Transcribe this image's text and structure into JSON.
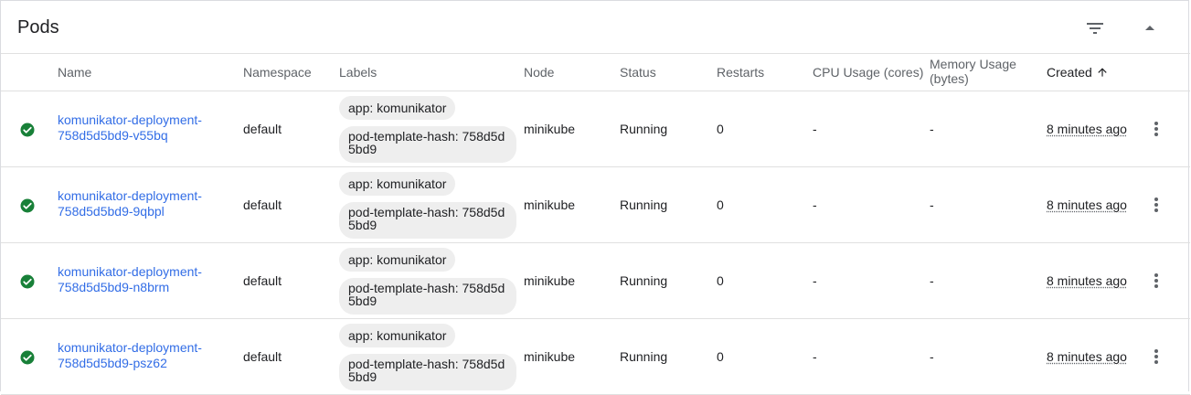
{
  "card": {
    "title": "Pods",
    "filter_icon": "filter-list-icon",
    "collapse_icon": "arrow-drop-up-icon"
  },
  "columns": {
    "name": "Name",
    "namespace": "Namespace",
    "labels": "Labels",
    "node": "Node",
    "status": "Status",
    "restarts": "Restarts",
    "cpu": "CPU Usage (cores)",
    "memory_line1": "Memory Usage",
    "memory_line2": "(bytes)",
    "created": "Created",
    "created_sort_icon": "arrow-upward-icon"
  },
  "colors": {
    "link": "#326de6",
    "success": "#188038",
    "chip_bg": "#eeeeee"
  },
  "pods": [
    {
      "status_icon": "check-circle-icon",
      "name_line1": "komunikator-deployment-",
      "name_line2": "758d5d5bd9-v55bq",
      "namespace": "default",
      "label1": "app: komunikator",
      "label2": "pod-template-hash: 758d5d5bd9",
      "node": "minikube",
      "status": "Running",
      "restarts": "0",
      "cpu": "-",
      "memory": "-",
      "created": "8 minutes ago"
    },
    {
      "status_icon": "check-circle-icon",
      "name_line1": "komunikator-deployment-",
      "name_line2": "758d5d5bd9-9qbpl",
      "namespace": "default",
      "label1": "app: komunikator",
      "label2": "pod-template-hash: 758d5d5bd9",
      "node": "minikube",
      "status": "Running",
      "restarts": "0",
      "cpu": "-",
      "memory": "-",
      "created": "8 minutes ago"
    },
    {
      "status_icon": "check-circle-icon",
      "name_line1": "komunikator-deployment-",
      "name_line2": "758d5d5bd9-n8brm",
      "namespace": "default",
      "label1": "app: komunikator",
      "label2": "pod-template-hash: 758d5d5bd9",
      "node": "minikube",
      "status": "Running",
      "restarts": "0",
      "cpu": "-",
      "memory": "-",
      "created": "8 minutes ago"
    },
    {
      "status_icon": "check-circle-icon",
      "name_line1": "komunikator-deployment-",
      "name_line2": "758d5d5bd9-psz62",
      "namespace": "default",
      "label1": "app: komunikator",
      "label2": "pod-template-hash: 758d5d5bd9",
      "node": "minikube",
      "status": "Running",
      "restarts": "0",
      "cpu": "-",
      "memory": "-",
      "created": "8 minutes ago"
    }
  ]
}
